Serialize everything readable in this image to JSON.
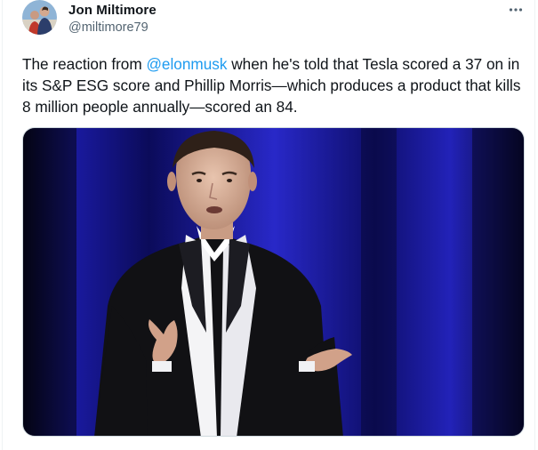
{
  "author": {
    "name": "Jon Miltimore",
    "handle": "@miltimore79"
  },
  "tweet": {
    "text_before": "The reaction from ",
    "mention": "@elonmusk",
    "text_after": "  when he's told that Tesla scored a 37 on in its S&P ESG score and Phillip Morris—which produces a product that kills 8 million people annually—scored an 84."
  },
  "icons": {
    "more": "more-horizontal-icon"
  },
  "colors": {
    "text": "#0f1419",
    "secondary": "#536471",
    "link": "#1d9bf0",
    "stage_blue": "#2a2ad0"
  }
}
